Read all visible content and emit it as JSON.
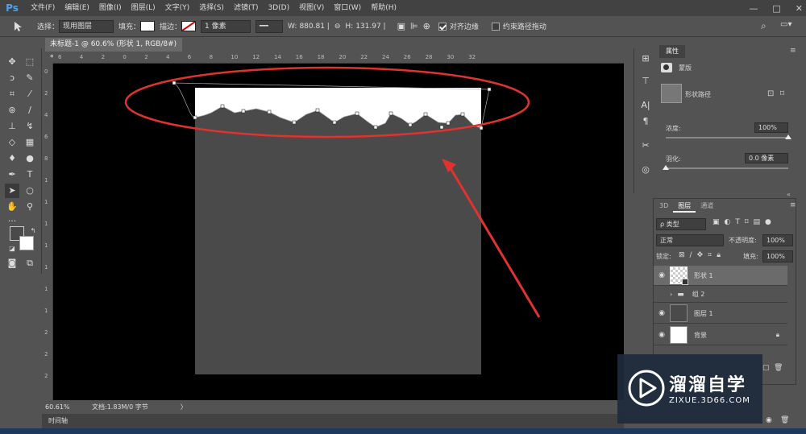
{
  "app": {
    "logo": "Ps"
  },
  "menu": [
    "文件(F)",
    "编辑(E)",
    "图像(I)",
    "图层(L)",
    "文字(Y)",
    "选择(S)",
    "滤镜(T)",
    "3D(D)",
    "视图(V)",
    "窗口(W)",
    "帮助(H)"
  ],
  "window_controls": {
    "minimize": "—",
    "maximize": "□",
    "close": "✕"
  },
  "options": {
    "select_label": "选择：",
    "select_value": "现用图层",
    "fill_label": "填充：",
    "stroke_label": "描边：",
    "stroke_size": "1 像素",
    "w_label": "W:",
    "w_value": "880.81 |",
    "h_label": "H:",
    "h_value": "131.97 |",
    "align_edges": "对齐边缘",
    "align_edges_checked": true,
    "constrain_path": "约束路径拖动",
    "constrain_path_checked": false
  },
  "document": {
    "tab_title": "未标题-1 @ 60.6% (形状 1, RGB/8#) *",
    "tab_close": "×",
    "zoom": "60.61%",
    "doc_info": "文档:1.83M/0 字节",
    "status_arrow": "〉",
    "timeline_label": "时间轴"
  },
  "ruler_h": [
    "6",
    "4",
    "2",
    "0",
    "2",
    "4",
    "6",
    "8",
    "10",
    "12",
    "14",
    "16",
    "18",
    "20",
    "22",
    "24",
    "26",
    "28",
    "30",
    "32"
  ],
  "ruler_v": [
    "0",
    "2",
    "4",
    "6",
    "8",
    "1",
    "1",
    "1",
    "1",
    "1",
    "1",
    "1",
    "2",
    "2",
    "2"
  ],
  "properties": {
    "tab": "属性",
    "mask_label": "蒙版",
    "shape_path_label": "形状路径",
    "density_label": "浓度:",
    "density_value": "100%",
    "feather_label": "羽化:",
    "feather_value": "0.0 像素"
  },
  "layers_panel": {
    "tabs": [
      "3D",
      "图层",
      "通道"
    ],
    "filter_kind": "ρ 类型",
    "blend_mode": "正常",
    "opacity_label": "不透明度:",
    "opacity_value": "100%",
    "lock_label": "锁定:",
    "fill_label": "填充:",
    "fill_value": "100%",
    "layers": [
      {
        "name": "形状 1",
        "selected": true,
        "visible": true
      },
      {
        "name": "组 2",
        "selected": false,
        "visible": false
      },
      {
        "name": "图层 1",
        "selected": false,
        "visible": true
      },
      {
        "name": "背景",
        "selected": false,
        "visible": true
      }
    ]
  },
  "watermark": {
    "title": "溜溜自学",
    "url": "ZIXUE.3D66.COM"
  },
  "colors": {
    "annotation_red": "#e0322f",
    "accent_blue": "#4aa3ef",
    "canvas_gray": "#4a4a4a"
  }
}
